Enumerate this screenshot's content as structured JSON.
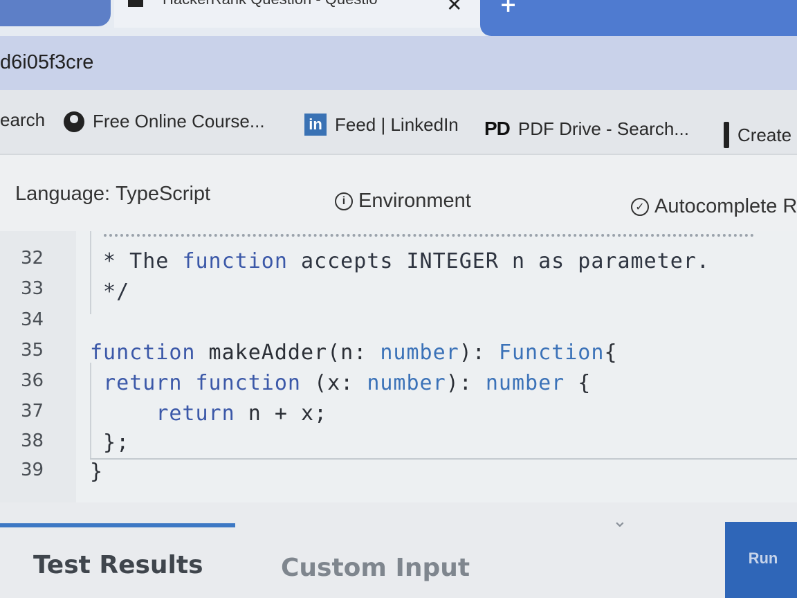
{
  "browser": {
    "tab_title": "HackerRank Question - Questio",
    "tab_close": "✕",
    "new_tab": "+",
    "url": "d6i05f3cre"
  },
  "bookmarks": [
    {
      "label": "earch",
      "icon": "search-icon"
    },
    {
      "label": "Free Online Course...",
      "icon": "globe-icon"
    },
    {
      "label": "Feed | LinkedIn",
      "icon": "linkedin-icon",
      "icon_text": "in"
    },
    {
      "label": "PDF Drive - Search...",
      "icon": "pdf-drive-icon",
      "icon_text": "PD"
    },
    {
      "label": "Create",
      "icon": "bookmark-icon"
    }
  ],
  "toolbar": {
    "language_label": "Language:",
    "language_value": "TypeScript",
    "environment": "Environment",
    "autocomplete": "Autocomplete R"
  },
  "editor": {
    "lines": [
      {
        "num": "32",
        "code": " * The function accepts INTEGER n as parameter."
      },
      {
        "num": "33",
        "code": " */"
      },
      {
        "num": "34",
        "code": ""
      },
      {
        "num": "35",
        "code": "function makeAdder(n: number): Function{"
      },
      {
        "num": "36",
        "code": " return function (x: number): number {"
      },
      {
        "num": "37",
        "code": "     return n + x;"
      },
      {
        "num": "38",
        "code": " };"
      },
      {
        "num": "39",
        "code": "}"
      }
    ]
  },
  "bottom": {
    "tab_test_results": "Test Results",
    "tab_custom_input": "Custom Input",
    "run_label": "Run",
    "chevron": "⌄"
  },
  "colors": {
    "keyword": "#3b58a8",
    "type": "#3b72b8",
    "accent": "#3d78c4",
    "run_button": "#2f66b8"
  }
}
